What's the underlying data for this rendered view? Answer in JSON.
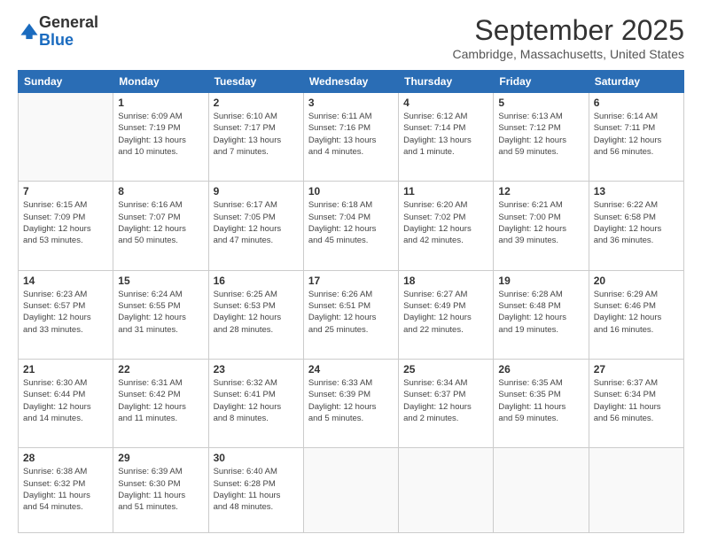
{
  "header": {
    "logo": {
      "line1": "General",
      "line2": "Blue"
    },
    "title": "September 2025",
    "location": "Cambridge, Massachusetts, United States"
  },
  "weekdays": [
    "Sunday",
    "Monday",
    "Tuesday",
    "Wednesday",
    "Thursday",
    "Friday",
    "Saturday"
  ],
  "weeks": [
    [
      {
        "day": "",
        "info": ""
      },
      {
        "day": "1",
        "info": "Sunrise: 6:09 AM\nSunset: 7:19 PM\nDaylight: 13 hours\nand 10 minutes."
      },
      {
        "day": "2",
        "info": "Sunrise: 6:10 AM\nSunset: 7:17 PM\nDaylight: 13 hours\nand 7 minutes."
      },
      {
        "day": "3",
        "info": "Sunrise: 6:11 AM\nSunset: 7:16 PM\nDaylight: 13 hours\nand 4 minutes."
      },
      {
        "day": "4",
        "info": "Sunrise: 6:12 AM\nSunset: 7:14 PM\nDaylight: 13 hours\nand 1 minute."
      },
      {
        "day": "5",
        "info": "Sunrise: 6:13 AM\nSunset: 7:12 PM\nDaylight: 12 hours\nand 59 minutes."
      },
      {
        "day": "6",
        "info": "Sunrise: 6:14 AM\nSunset: 7:11 PM\nDaylight: 12 hours\nand 56 minutes."
      }
    ],
    [
      {
        "day": "7",
        "info": "Sunrise: 6:15 AM\nSunset: 7:09 PM\nDaylight: 12 hours\nand 53 minutes."
      },
      {
        "day": "8",
        "info": "Sunrise: 6:16 AM\nSunset: 7:07 PM\nDaylight: 12 hours\nand 50 minutes."
      },
      {
        "day": "9",
        "info": "Sunrise: 6:17 AM\nSunset: 7:05 PM\nDaylight: 12 hours\nand 47 minutes."
      },
      {
        "day": "10",
        "info": "Sunrise: 6:18 AM\nSunset: 7:04 PM\nDaylight: 12 hours\nand 45 minutes."
      },
      {
        "day": "11",
        "info": "Sunrise: 6:20 AM\nSunset: 7:02 PM\nDaylight: 12 hours\nand 42 minutes."
      },
      {
        "day": "12",
        "info": "Sunrise: 6:21 AM\nSunset: 7:00 PM\nDaylight: 12 hours\nand 39 minutes."
      },
      {
        "day": "13",
        "info": "Sunrise: 6:22 AM\nSunset: 6:58 PM\nDaylight: 12 hours\nand 36 minutes."
      }
    ],
    [
      {
        "day": "14",
        "info": "Sunrise: 6:23 AM\nSunset: 6:57 PM\nDaylight: 12 hours\nand 33 minutes."
      },
      {
        "day": "15",
        "info": "Sunrise: 6:24 AM\nSunset: 6:55 PM\nDaylight: 12 hours\nand 31 minutes."
      },
      {
        "day": "16",
        "info": "Sunrise: 6:25 AM\nSunset: 6:53 PM\nDaylight: 12 hours\nand 28 minutes."
      },
      {
        "day": "17",
        "info": "Sunrise: 6:26 AM\nSunset: 6:51 PM\nDaylight: 12 hours\nand 25 minutes."
      },
      {
        "day": "18",
        "info": "Sunrise: 6:27 AM\nSunset: 6:49 PM\nDaylight: 12 hours\nand 22 minutes."
      },
      {
        "day": "19",
        "info": "Sunrise: 6:28 AM\nSunset: 6:48 PM\nDaylight: 12 hours\nand 19 minutes."
      },
      {
        "day": "20",
        "info": "Sunrise: 6:29 AM\nSunset: 6:46 PM\nDaylight: 12 hours\nand 16 minutes."
      }
    ],
    [
      {
        "day": "21",
        "info": "Sunrise: 6:30 AM\nSunset: 6:44 PM\nDaylight: 12 hours\nand 14 minutes."
      },
      {
        "day": "22",
        "info": "Sunrise: 6:31 AM\nSunset: 6:42 PM\nDaylight: 12 hours\nand 11 minutes."
      },
      {
        "day": "23",
        "info": "Sunrise: 6:32 AM\nSunset: 6:41 PM\nDaylight: 12 hours\nand 8 minutes."
      },
      {
        "day": "24",
        "info": "Sunrise: 6:33 AM\nSunset: 6:39 PM\nDaylight: 12 hours\nand 5 minutes."
      },
      {
        "day": "25",
        "info": "Sunrise: 6:34 AM\nSunset: 6:37 PM\nDaylight: 12 hours\nand 2 minutes."
      },
      {
        "day": "26",
        "info": "Sunrise: 6:35 AM\nSunset: 6:35 PM\nDaylight: 11 hours\nand 59 minutes."
      },
      {
        "day": "27",
        "info": "Sunrise: 6:37 AM\nSunset: 6:34 PM\nDaylight: 11 hours\nand 56 minutes."
      }
    ],
    [
      {
        "day": "28",
        "info": "Sunrise: 6:38 AM\nSunset: 6:32 PM\nDaylight: 11 hours\nand 54 minutes."
      },
      {
        "day": "29",
        "info": "Sunrise: 6:39 AM\nSunset: 6:30 PM\nDaylight: 11 hours\nand 51 minutes."
      },
      {
        "day": "30",
        "info": "Sunrise: 6:40 AM\nSunset: 6:28 PM\nDaylight: 11 hours\nand 48 minutes."
      },
      {
        "day": "",
        "info": ""
      },
      {
        "day": "",
        "info": ""
      },
      {
        "day": "",
        "info": ""
      },
      {
        "day": "",
        "info": ""
      }
    ]
  ]
}
